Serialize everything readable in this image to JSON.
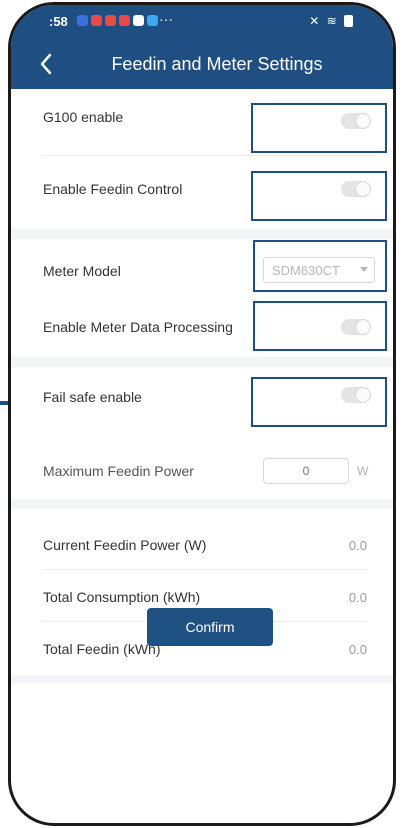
{
  "status_bar": {
    "time": ":58",
    "more_indicator": "···",
    "notification_colors": [
      "#3d6fe0",
      "#e84a4a",
      "#e84a4a",
      "#e84a4a",
      "#ffffff",
      "#3da8ea"
    ]
  },
  "header": {
    "title": "Feedin and Meter Settings",
    "background": "#1f4f82"
  },
  "settings": {
    "g100_enable": {
      "label": "G100 enable",
      "enabled": false
    },
    "feedin_control": {
      "label": "Enable Feedin Control",
      "enabled": false
    },
    "meter_model": {
      "label": "Meter Model",
      "selected": "SDM630CT"
    },
    "meter_data_processing": {
      "label": "Enable Meter Data Processing",
      "enabled": false
    },
    "fail_safe": {
      "label": "Fail safe enable",
      "enabled": false
    },
    "max_feedin_power": {
      "label": "Maximum Feedin Power",
      "placeholder": "0",
      "unit": "W"
    }
  },
  "readings": {
    "current_feedin": {
      "label": "Current Feedin Power (W)",
      "value": "0.0"
    },
    "total_consumption": {
      "label": "Total Consumption (kWh)",
      "value": "0.0"
    },
    "total_feedin": {
      "label": "Total Feedin (kWh)",
      "value": "0.0"
    }
  },
  "confirm_label": "Confirm",
  "highlight_color": "#1f4f82"
}
